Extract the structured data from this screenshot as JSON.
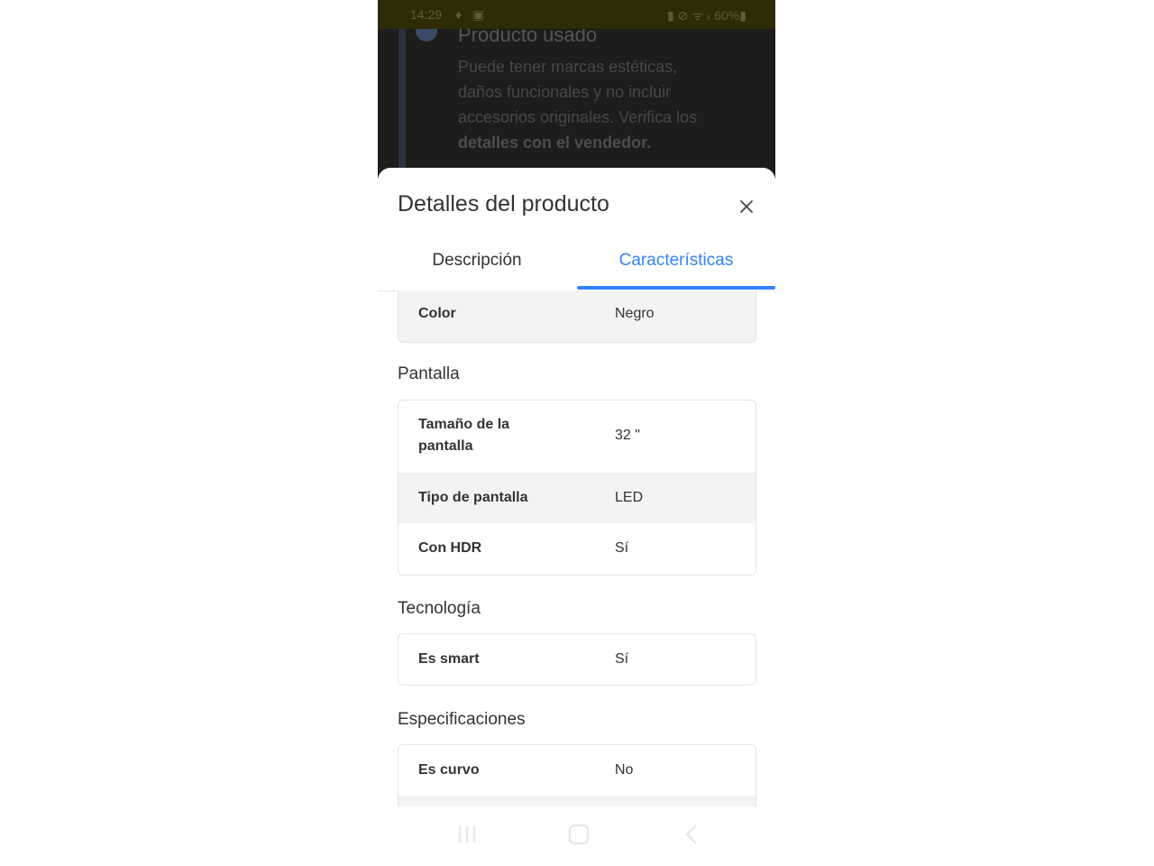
{
  "status_bar": {
    "time": "14:29",
    "left_icons": "♦ ▣",
    "right": "▮ ⊘ ᯤ ᵢₗ 60%▮"
  },
  "background_page": {
    "title": "Producto usado",
    "text": "Puede tener marcas estéticas, daños funcionales y no incluir accesorios originales. Verifica los",
    "text_bold": "detalles con el vendedor."
  },
  "sheet": {
    "title": "Detalles del producto",
    "close_icon": "close-icon",
    "tabs": [
      {
        "label": "Descripción",
        "active": false
      },
      {
        "label": "Características",
        "active": true
      }
    ],
    "accent_color": "#3483fa"
  },
  "groups": {
    "top": {
      "rows": [
        {
          "label": "Color",
          "value": "Negro"
        }
      ]
    },
    "pantalla": {
      "title": "Pantalla",
      "rows": [
        {
          "label": "Tamaño de la pantalla",
          "value": "32 \""
        },
        {
          "label": "Tipo de pantalla",
          "value": "LED"
        },
        {
          "label": "Con HDR",
          "value": "Sí"
        }
      ]
    },
    "tecnologia": {
      "title": "Tecnología",
      "rows": [
        {
          "label": "Es smart",
          "value": "Sí"
        }
      ]
    },
    "especificaciones": {
      "title": "Especificaciones",
      "rows": [
        {
          "label": "Es curvo",
          "value": "No"
        }
      ]
    }
  },
  "nav_bar": {
    "icons": [
      "recent-apps-icon",
      "home-icon",
      "back-icon"
    ]
  }
}
